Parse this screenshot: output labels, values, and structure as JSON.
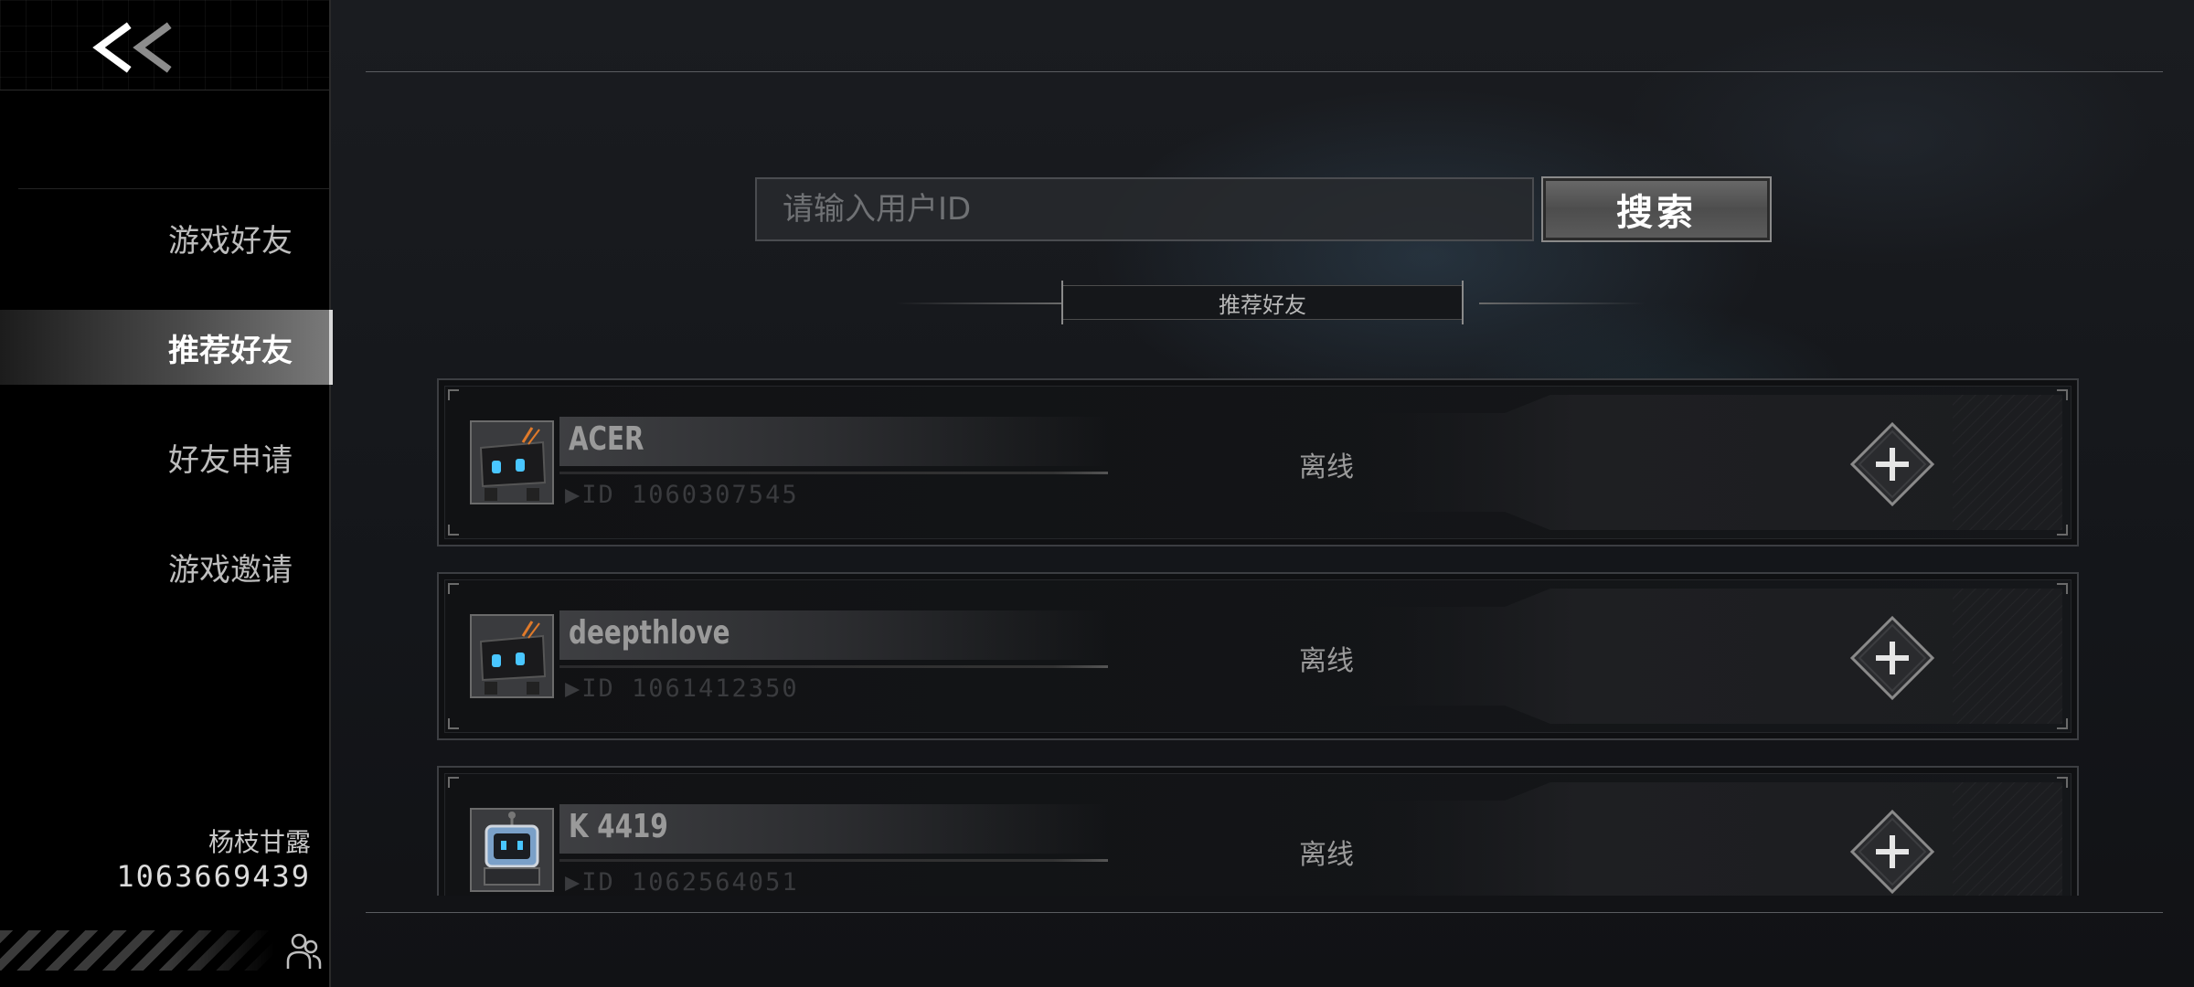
{
  "sidebar": {
    "back_icon": "double-chevron-left-icon",
    "items": [
      {
        "label": "游戏好友",
        "active": false
      },
      {
        "label": "推荐好友",
        "active": true
      },
      {
        "label": "好友申请",
        "active": false
      },
      {
        "label": "游戏邀请",
        "active": false
      }
    ],
    "user": {
      "name": "杨枝甘露",
      "id": "1063669439"
    },
    "friends_icon": "friends-icon"
  },
  "search": {
    "placeholder": "请输入用户ID",
    "button_label": "搜索"
  },
  "section": {
    "title": "推荐好友"
  },
  "friends": [
    {
      "name": "ACER",
      "id_text": "▶ID 1060307545",
      "status": "离线",
      "avatar": "robot-avatar",
      "add_icon": "plus-icon"
    },
    {
      "name": "deepthlove",
      "id_text": "▶ID 1061412350",
      "status": "离线",
      "avatar": "robot-avatar",
      "add_icon": "plus-icon"
    },
    {
      "name": "K 4419",
      "id_text": "▶ID 1062564051",
      "status": "离线",
      "avatar": "robot-avatar-blue",
      "add_icon": "plus-icon"
    }
  ],
  "colors": {
    "accent": "#ffffff",
    "background": "#14161a",
    "sidebar": "#000000",
    "active_tab": "#6e6e6e"
  }
}
